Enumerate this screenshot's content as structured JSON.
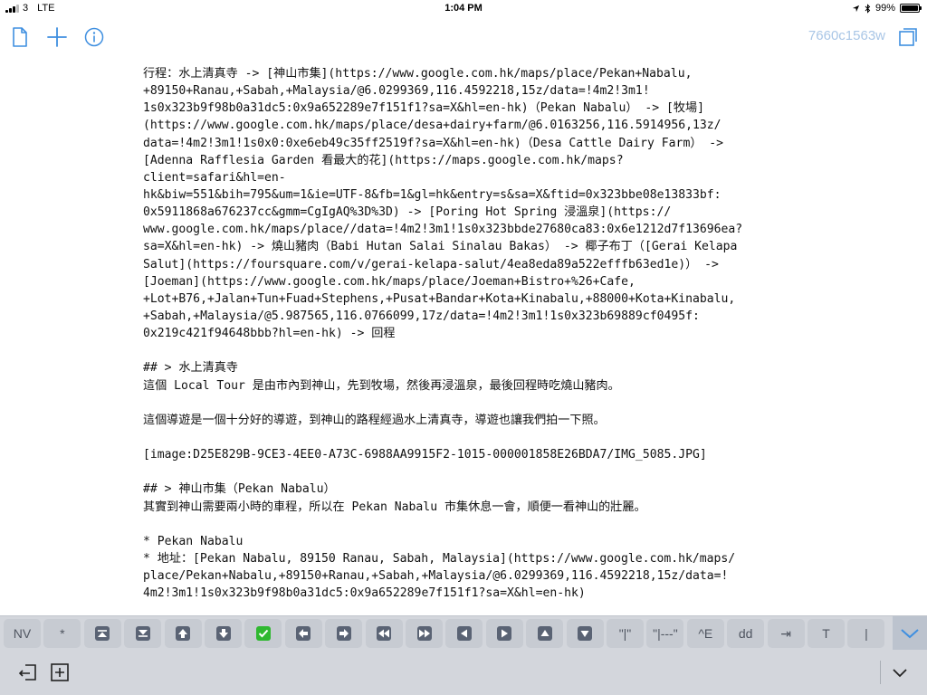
{
  "status_bar": {
    "carrier": "3",
    "network": "LTE",
    "time": "1:04 PM",
    "battery": "99%",
    "battery_level": 0.99,
    "icons": [
      "signal-icon",
      "location-arrow-icon",
      "bluetooth-icon",
      "battery-icon"
    ]
  },
  "toolbar": {
    "icons": [
      "document-icon",
      "plus-icon",
      "info-icon",
      "fullscreen-icon"
    ],
    "document_id": "7660c1563w",
    "accent_color": "#3f8fe0"
  },
  "editor": {
    "lines": [
      "行程：水上清真寺 -> [神山市集](https://www.google.com.hk/maps/place/Pekan+Nabalu,",
      "+89150+Ranau,+Sabah,+Malaysia/@6.0299369,116.4592218,15z/data=!4m2!3m1!",
      "1s0x323b9f98b0a31dc5:0x9a652289e7f151f1?sa=X&hl=en-hk)（Pekan Nabalu） -> [牧場]",
      "(https://www.google.com.hk/maps/place/desa+dairy+farm/@6.0163256,116.5914956,13z/",
      "data=!4m2!3m1!1s0x0:0xe6eb49c35ff2519f?sa=X&hl=en-hk)（Desa Cattle Dairy Farm） ->",
      "[Adenna Rafflesia Garden 看最大的花](https://maps.google.com.hk/maps?",
      "client=safari&hl=en-",
      "hk&biw=551&bih=795&um=1&ie=UTF-8&fb=1&gl=hk&entry=s&sa=X&ftid=0x323bbe08e13833bf:",
      "0x5911868a676237cc&gmm=CgIgAQ%3D%3D) -> [Poring Hot Spring 浸溫泉](https://",
      "www.google.com.hk/maps/place//data=!4m2!3m1!1s0x323bbde27680ca83:0x6e1212d7f13696ea?",
      "sa=X&hl=en-hk) -> 燒山豬肉（Babi Hutan Salai Sinalau Bakas） -> 椰子布丁（[Gerai Kelapa",
      "Salut](https://foursquare.com/v/gerai-kelapa-salut/4ea8eda89a522efffb63ed1e)） ->",
      "[Joeman](https://www.google.com.hk/maps/place/Joeman+Bistro+%26+Cafe,",
      "+Lot+B76,+Jalan+Tun+Fuad+Stephens,+Pusat+Bandar+Kota+Kinabalu,+88000+Kota+Kinabalu,",
      "+Sabah,+Malaysia/@5.987565,116.0766099,17z/data=!4m2!3m1!1s0x323b69889cf0495f:",
      "0x219c421f94648bbb?hl=en-hk) -> 回程",
      "",
      "## > 水上清真寺",
      "這個 Local Tour 是由市內到神山，先到牧場，然後再浸溫泉，最後回程時吃燒山豬肉。",
      "",
      "這個導遊是一個十分好的導遊，到神山的路程經過水上清真寺，導遊也讓我們拍一下照。",
      "",
      "[image:D25E829B-9CE3-4EE0-A73C-6988AA9915F2-1015-000001858E26BDA7/IMG_5085.JPG]",
      "",
      "## > 神山市集（Pekan Nabalu）",
      "其實到神山需要兩小時的車程，所以在 Pekan Nabalu 市集休息一會，順便一看神山的壯麗。",
      "",
      "* Pekan Nabalu",
      "* 地址：[Pekan Nabalu, 89150 Ranau, Sabah, Malaysia](https://www.google.com.hk/maps/",
      "place/Pekan+Nabalu,+89150+Ranau,+Sabah,+Malaysia/@6.0299369,116.4592218,15z/data=!",
      "4m2!3m1!1s0x323b9f98b0a31dc5:0x9a652289e7f151f1?sa=X&hl=en-hk)"
    ]
  },
  "accessory_bar": {
    "buttons": [
      {
        "name": "nv-button",
        "label": "NV",
        "icon": ""
      },
      {
        "name": "asterisk-button",
        "label": "*",
        "icon": ""
      },
      {
        "name": "page-up-button",
        "label": "",
        "icon": "arrow-up-bar-icon"
      },
      {
        "name": "page-down-button",
        "label": "",
        "icon": "arrow-down-bar-icon"
      },
      {
        "name": "cursor-up-button",
        "label": "",
        "icon": "arrow-up-icon"
      },
      {
        "name": "cursor-down-button",
        "label": "",
        "icon": "arrow-down-icon"
      },
      {
        "name": "checkmark-button",
        "label": "",
        "icon": "checkmark-icon"
      },
      {
        "name": "cursor-left-button",
        "label": "",
        "icon": "arrow-left-icon"
      },
      {
        "name": "cursor-right-button",
        "label": "",
        "icon": "arrow-right-icon"
      },
      {
        "name": "rewind-button",
        "label": "",
        "icon": "rewind-icon"
      },
      {
        "name": "fast-forward-button",
        "label": "",
        "icon": "fast-forward-icon"
      },
      {
        "name": "triangle-left-button",
        "label": "",
        "icon": "triangle-left-icon"
      },
      {
        "name": "triangle-right-button",
        "label": "",
        "icon": "triangle-right-icon"
      },
      {
        "name": "triangle-up-button",
        "label": "",
        "icon": "triangle-up-icon"
      },
      {
        "name": "triangle-down-button",
        "label": "",
        "icon": "triangle-down-icon"
      },
      {
        "name": "pipe-quote-button",
        "label": "\"|\"",
        "icon": ""
      },
      {
        "name": "table-separator-button",
        "label": "\"|---\"",
        "icon": ""
      },
      {
        "name": "ctrl-e-button",
        "label": "^E",
        "icon": ""
      },
      {
        "name": "dd-button",
        "label": "dd",
        "icon": ""
      },
      {
        "name": "tab-button",
        "label": "⇥",
        "icon": ""
      },
      {
        "name": "t-button",
        "label": "T",
        "icon": ""
      },
      {
        "name": "pipe-button",
        "label": "|",
        "icon": ""
      }
    ],
    "collapse_icon": "chevron-down-icon",
    "check_color": "#2fb830"
  },
  "keyboard_bar": {
    "icons": [
      "undo-icon",
      "add-box-icon",
      "dismiss-keyboard-icon"
    ]
  }
}
